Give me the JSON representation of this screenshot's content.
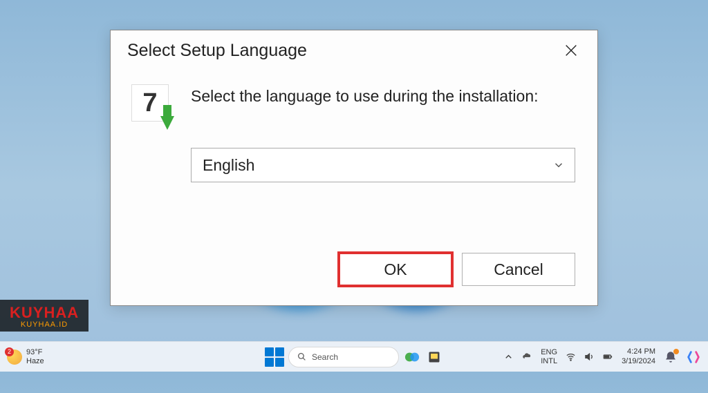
{
  "dialog": {
    "title": "Select Setup Language",
    "instruction": "Select the language to use during the installation:",
    "selected_language": "English",
    "ok_label": "OK",
    "cancel_label": "Cancel"
  },
  "watermark": {
    "brand": "KUYHAA",
    "sub": "KUYHAA.ID"
  },
  "taskbar": {
    "weather_temp": "93°F",
    "weather_cond": "Haze",
    "search_placeholder": "Search",
    "lang_top": "ENG",
    "lang_bottom": "INTL",
    "time": "4:24 PM",
    "date": "3/19/2024"
  },
  "colors": {
    "highlight_red": "#e03030",
    "win_blue": "#0078d4"
  }
}
